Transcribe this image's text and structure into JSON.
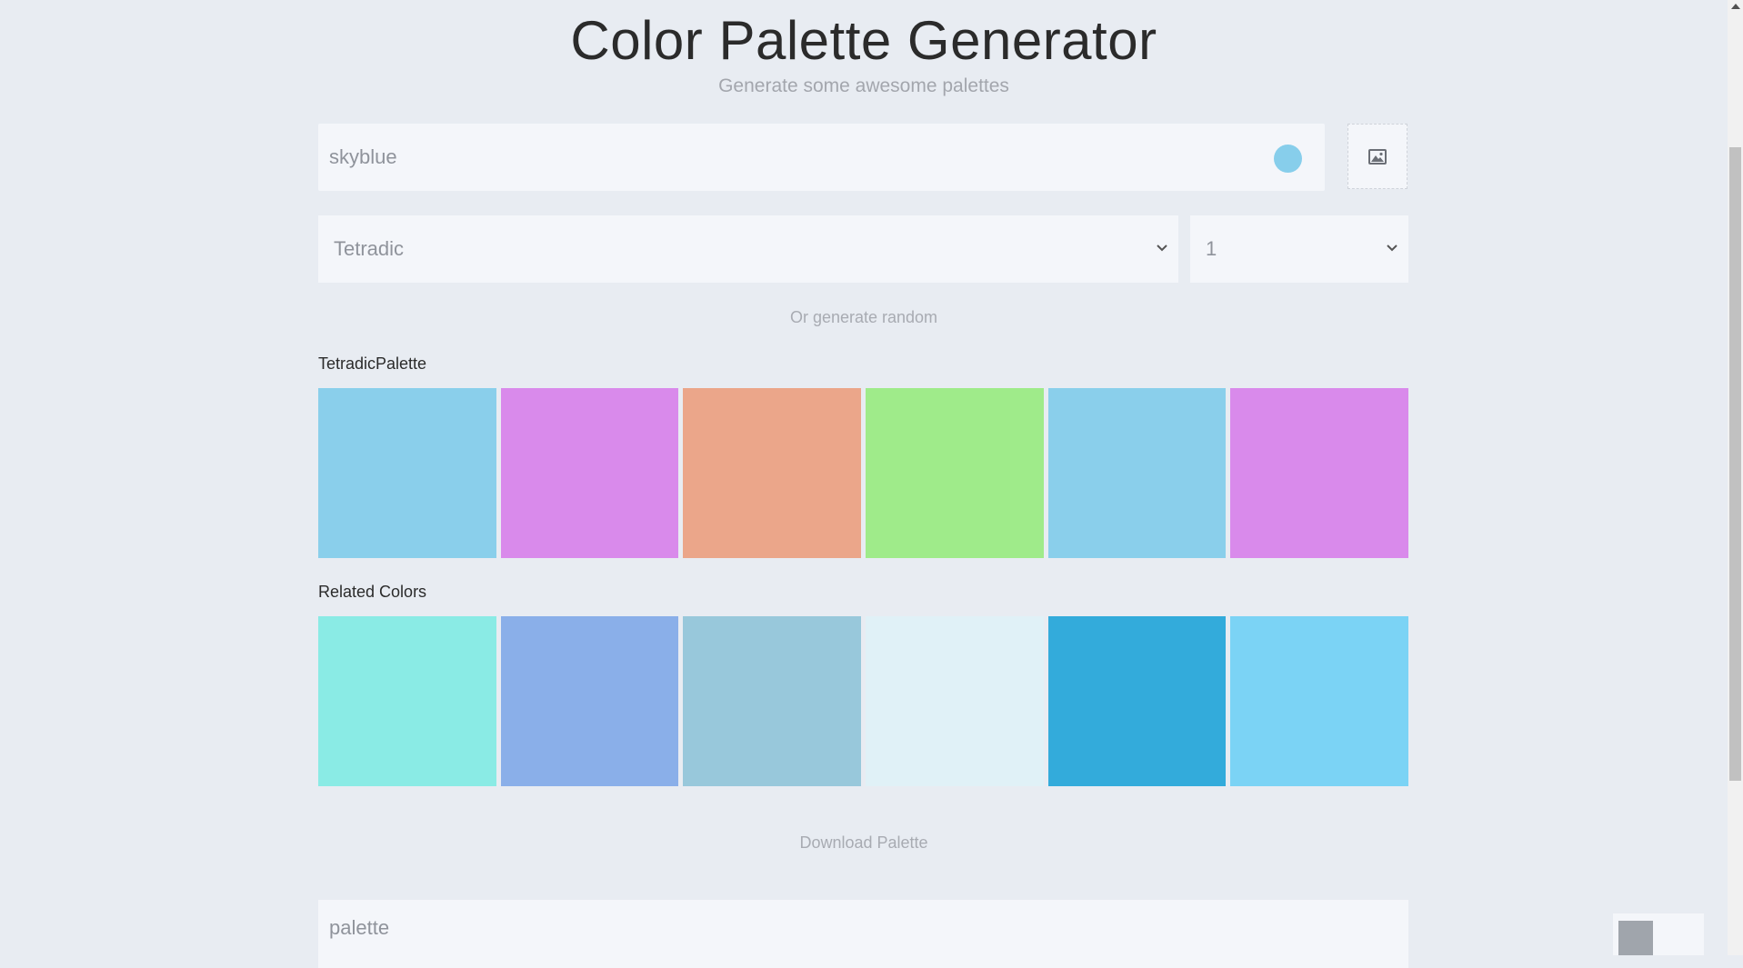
{
  "header": {
    "title": "Color Palette Generator",
    "subtitle": "Generate some awesome palettes"
  },
  "color_input": {
    "value": "skyblue",
    "swatch_color": "#87ceeb"
  },
  "image_upload": {
    "icon": "image-icon"
  },
  "scheme_select": {
    "value": "Tetradic"
  },
  "count_select": {
    "value": "1"
  },
  "random_link": "Or generate random",
  "palette": {
    "label": "TetradicPalette",
    "colors": [
      "#8acfeb",
      "#d98aeb",
      "#eba68a",
      "#9feb8a",
      "#8acfeb",
      "#d98aeb"
    ]
  },
  "related": {
    "label": "Related Colors",
    "colors": [
      "#8aebe5",
      "#8aafe9",
      "#98c8db",
      "#e0f1f7",
      "#33abdb",
      "#7bd3f5"
    ]
  },
  "download_link": "Download Palette",
  "name_input": {
    "value": "palette"
  }
}
